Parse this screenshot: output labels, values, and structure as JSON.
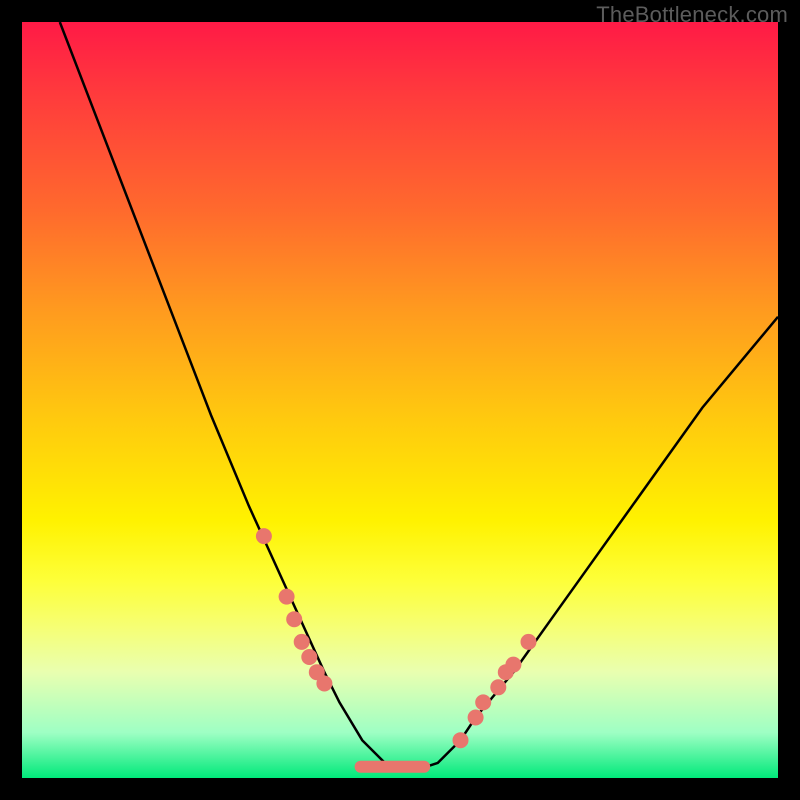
{
  "watermark": "TheBottleneck.com",
  "colors": {
    "dot": "#e8766d",
    "curve": "#000000",
    "gradient_top": "#ff1a46",
    "gradient_bottom": "#00e97a"
  },
  "chart_data": {
    "type": "line",
    "title": "",
    "xlabel": "",
    "ylabel": "",
    "xlim": [
      0,
      100
    ],
    "ylim": [
      0,
      100
    ],
    "grid": false,
    "legend": false,
    "series": [
      {
        "name": "bottleneck-curve",
        "x": [
          5,
          10,
          15,
          20,
          25,
          30,
          35,
          40,
          42,
          45,
          48,
          50,
          52,
          55,
          58,
          60,
          65,
          70,
          75,
          80,
          85,
          90,
          95,
          100
        ],
        "y": [
          100,
          87,
          74,
          61,
          48,
          36,
          25,
          14,
          10,
          5,
          2,
          1,
          1,
          2,
          5,
          8,
          14,
          21,
          28,
          35,
          42,
          49,
          55,
          61
        ]
      }
    ],
    "markers": [
      {
        "name": "left-outlier-1",
        "x": 32,
        "y": 32
      },
      {
        "name": "left-cluster-1",
        "x": 35,
        "y": 24
      },
      {
        "name": "left-cluster-2",
        "x": 36,
        "y": 21
      },
      {
        "name": "left-cluster-3",
        "x": 37,
        "y": 18
      },
      {
        "name": "left-cluster-4",
        "x": 38,
        "y": 16
      },
      {
        "name": "left-cluster-5",
        "x": 39,
        "y": 14
      },
      {
        "name": "left-cluster-6",
        "x": 40,
        "y": 12.5
      },
      {
        "name": "right-cluster-1",
        "x": 58,
        "y": 5
      },
      {
        "name": "right-cluster-2",
        "x": 60,
        "y": 8
      },
      {
        "name": "right-cluster-3",
        "x": 61,
        "y": 10
      },
      {
        "name": "right-cluster-4",
        "x": 63,
        "y": 12
      },
      {
        "name": "right-cluster-5",
        "x": 64,
        "y": 14
      },
      {
        "name": "right-cluster-6",
        "x": 65,
        "y": 15
      },
      {
        "name": "right-outlier-1",
        "x": 67,
        "y": 18
      }
    ],
    "flat_segment": {
      "x0": 44,
      "x1": 54,
      "y": 1.5
    }
  }
}
